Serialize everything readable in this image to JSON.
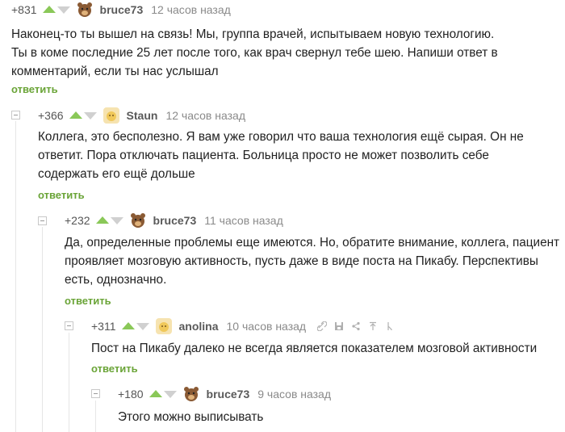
{
  "colors": {
    "upvote": "#8ac858",
    "downvote": "#d0d0d0",
    "reply": "#6aa437",
    "username": "#5a5a5a",
    "time": "#8a8a8a"
  },
  "comments": [
    {
      "rating": "+831",
      "username": "bruce73",
      "time": "12 часов назад",
      "avatar": "bear-avatar-icon",
      "lines": [
        "Наконец-то ты вышел на связь! Мы, группа врачей, испытываем новую технологию.",
        "Ты в коме последние 25 лет после того, как врач свернул тебе шею. Напиши ответ в",
        "комментарий, если ты нас услышал"
      ],
      "reply": "ответить"
    },
    {
      "rating": "+366",
      "username": "Staun",
      "time": "12 часов назад",
      "avatar": "default-avatar-icon",
      "lines": [
        "Коллега, это бесполезно. Я вам уже говорил что ваша технология ещё сырая. Он не",
        "ответит. Пора отключать пациента. Больница просто не может позволить себе",
        "содержать его ещё дольше"
      ],
      "reply": "ответить"
    },
    {
      "rating": "+232",
      "username": "bruce73",
      "time": "11 часов назад",
      "avatar": "bear-avatar-icon",
      "lines": [
        "Да, определенные проблемы еще имеются. Но, обратите внимание, коллега, пациент",
        "проявляет мозговую активность, пусть даже в виде поста на Пикабу. Перспективы",
        "есть, однозначно."
      ],
      "reply": "ответить"
    },
    {
      "rating": "+311",
      "username": "anolina",
      "time": "10 часов назад",
      "avatar": "default-avatar-icon",
      "lines": [
        "Пост на Пикабу далеко не всегда является показателем мозговой активности"
      ],
      "reply": "ответить",
      "actions": [
        "link-icon",
        "save-icon",
        "share-icon",
        "parent-comment-icon",
        "branch-icon"
      ]
    },
    {
      "rating": "+180",
      "username": "bruce73",
      "time": "9 часов назад",
      "avatar": "bear-avatar-icon",
      "lines": [
        "Этого можно выписывать"
      ]
    }
  ]
}
